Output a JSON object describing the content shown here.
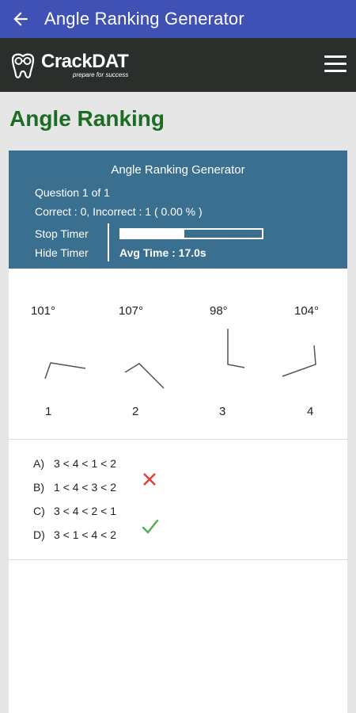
{
  "appbar": {
    "title": "Angle Ranking Generator",
    "back_icon": "arrow-left-icon"
  },
  "navbar": {
    "brand_name": "CrackDAT",
    "brand_tagline": "prepare for success",
    "menu_icon": "hamburger-icon"
  },
  "page": {
    "title": "Angle Ranking"
  },
  "generator": {
    "title": "Angle Ranking Generator",
    "question": "Question 1 of 1",
    "score": "Correct : 0, Incorrect : 1 ( 0.00 % )",
    "stop_timer": "Stop Timer",
    "hide_timer": "Hide Timer",
    "avg_time": "Avg Time : 17.0s",
    "timer_progress": 0.45
  },
  "angles": [
    {
      "degrees": "101°",
      "number": "1"
    },
    {
      "degrees": "107°",
      "number": "2"
    },
    {
      "degrees": "98°",
      "number": "3"
    },
    {
      "degrees": "104°",
      "number": "4"
    }
  ],
  "answers": [
    {
      "letter": "A)",
      "text": "3 < 4 < 1 < 2",
      "mark": ""
    },
    {
      "letter": "B)",
      "text": "1 < 4 < 3 < 2",
      "mark": "incorrect"
    },
    {
      "letter": "C)",
      "text": "3 < 4 < 2 < 1",
      "mark": ""
    },
    {
      "letter": "D)",
      "text": "3 < 1 < 4 < 2",
      "mark": "correct"
    }
  ],
  "colors": {
    "appbar": "#3f51b5",
    "navbar": "#2b2f2c",
    "title_green": "#1e6b24",
    "card_header": "#3a6f8f",
    "incorrect_red": "#e53935",
    "correct_green": "#4caf50"
  }
}
